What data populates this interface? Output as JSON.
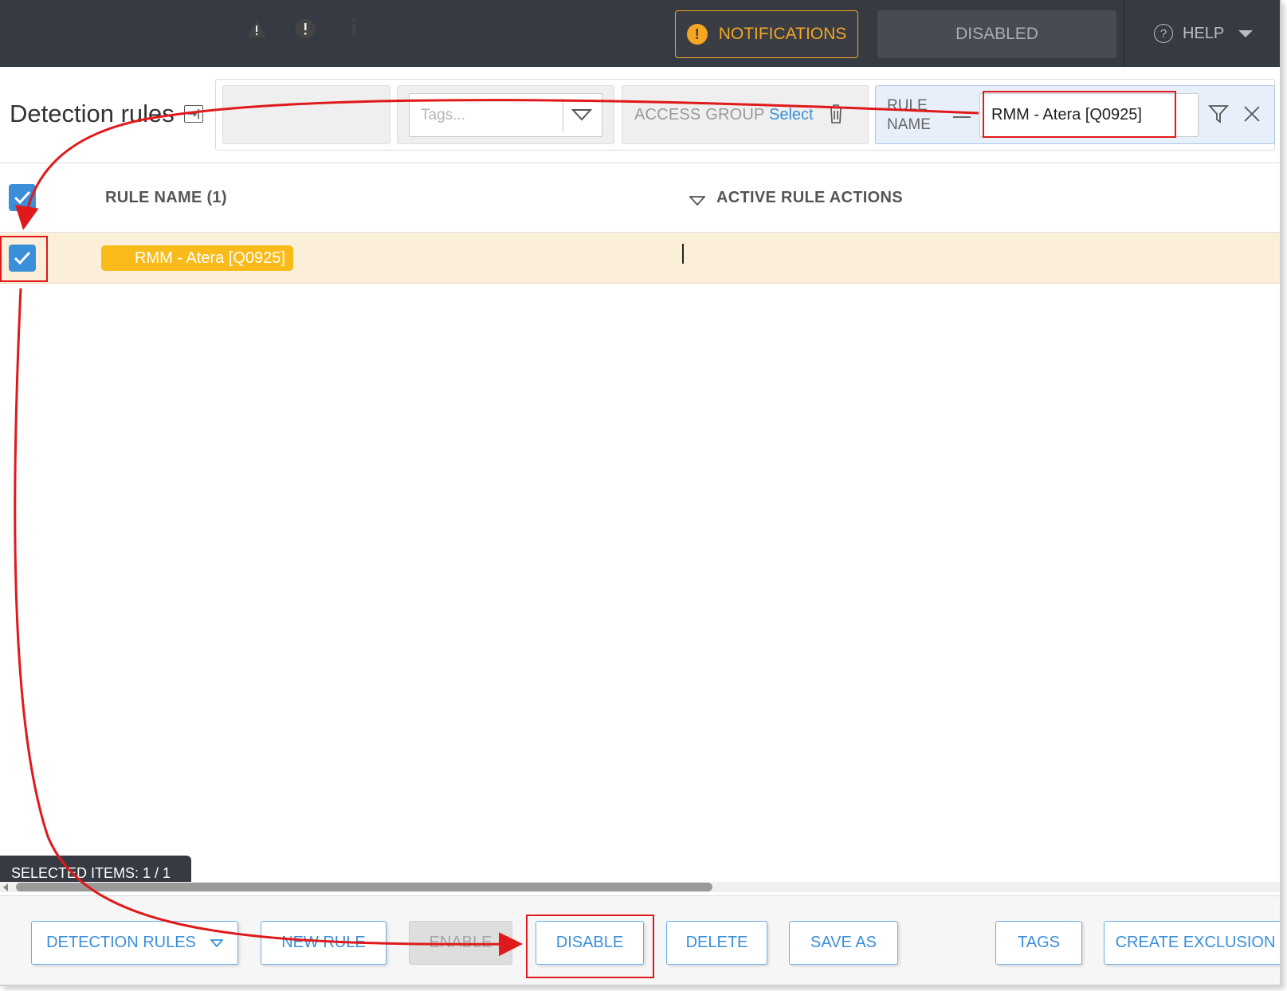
{
  "topbar": {
    "notifications_label": "NOTIFICATIONS",
    "notifications_badge": "!",
    "disabled_label": "DISABLED",
    "help_label": "HELP",
    "help_icon_glyph": "?"
  },
  "header": {
    "title": "Detection rules"
  },
  "filters": {
    "severity_icons": [
      "warning-triangle-icon",
      "error-octagon-icon",
      "info-icon"
    ],
    "severity_info_glyph": "i",
    "tags_placeholder": "Tags...",
    "access_group_label": "ACCESS GROUP",
    "access_group_select": "Select",
    "rule_name_label": "RULE NAME",
    "rule_name_value": "RMM - Atera [Q0925]"
  },
  "table": {
    "columns": [
      {
        "label": "RULE NAME (1)"
      },
      {
        "label": "ACTIVE RULE ACTIONS"
      }
    ],
    "rows": [
      {
        "rule_name": "RMM - Atera [Q0925]",
        "selected": true,
        "highlight_color": "#fbefd9",
        "pill_color": "#f9bb1a"
      }
    ]
  },
  "status": {
    "selected_items": "SELECTED ITEMS: 1 / 1"
  },
  "footer": {
    "buttons": [
      {
        "label": "DETECTION RULES"
      },
      {
        "label": "NEW RULE"
      },
      {
        "label": "ENABLE"
      },
      {
        "label": "DISABLE"
      },
      {
        "label": "DELETE"
      },
      {
        "label": "SAVE AS"
      },
      {
        "label": "TAGS"
      },
      {
        "label": "CREATE EXCLUSION"
      }
    ]
  },
  "colors": {
    "topbar_bg": "#363a43",
    "accent_orange": "#f5a623",
    "accent_blue": "#3a8fd8",
    "annotation_red": "#e0191b"
  }
}
